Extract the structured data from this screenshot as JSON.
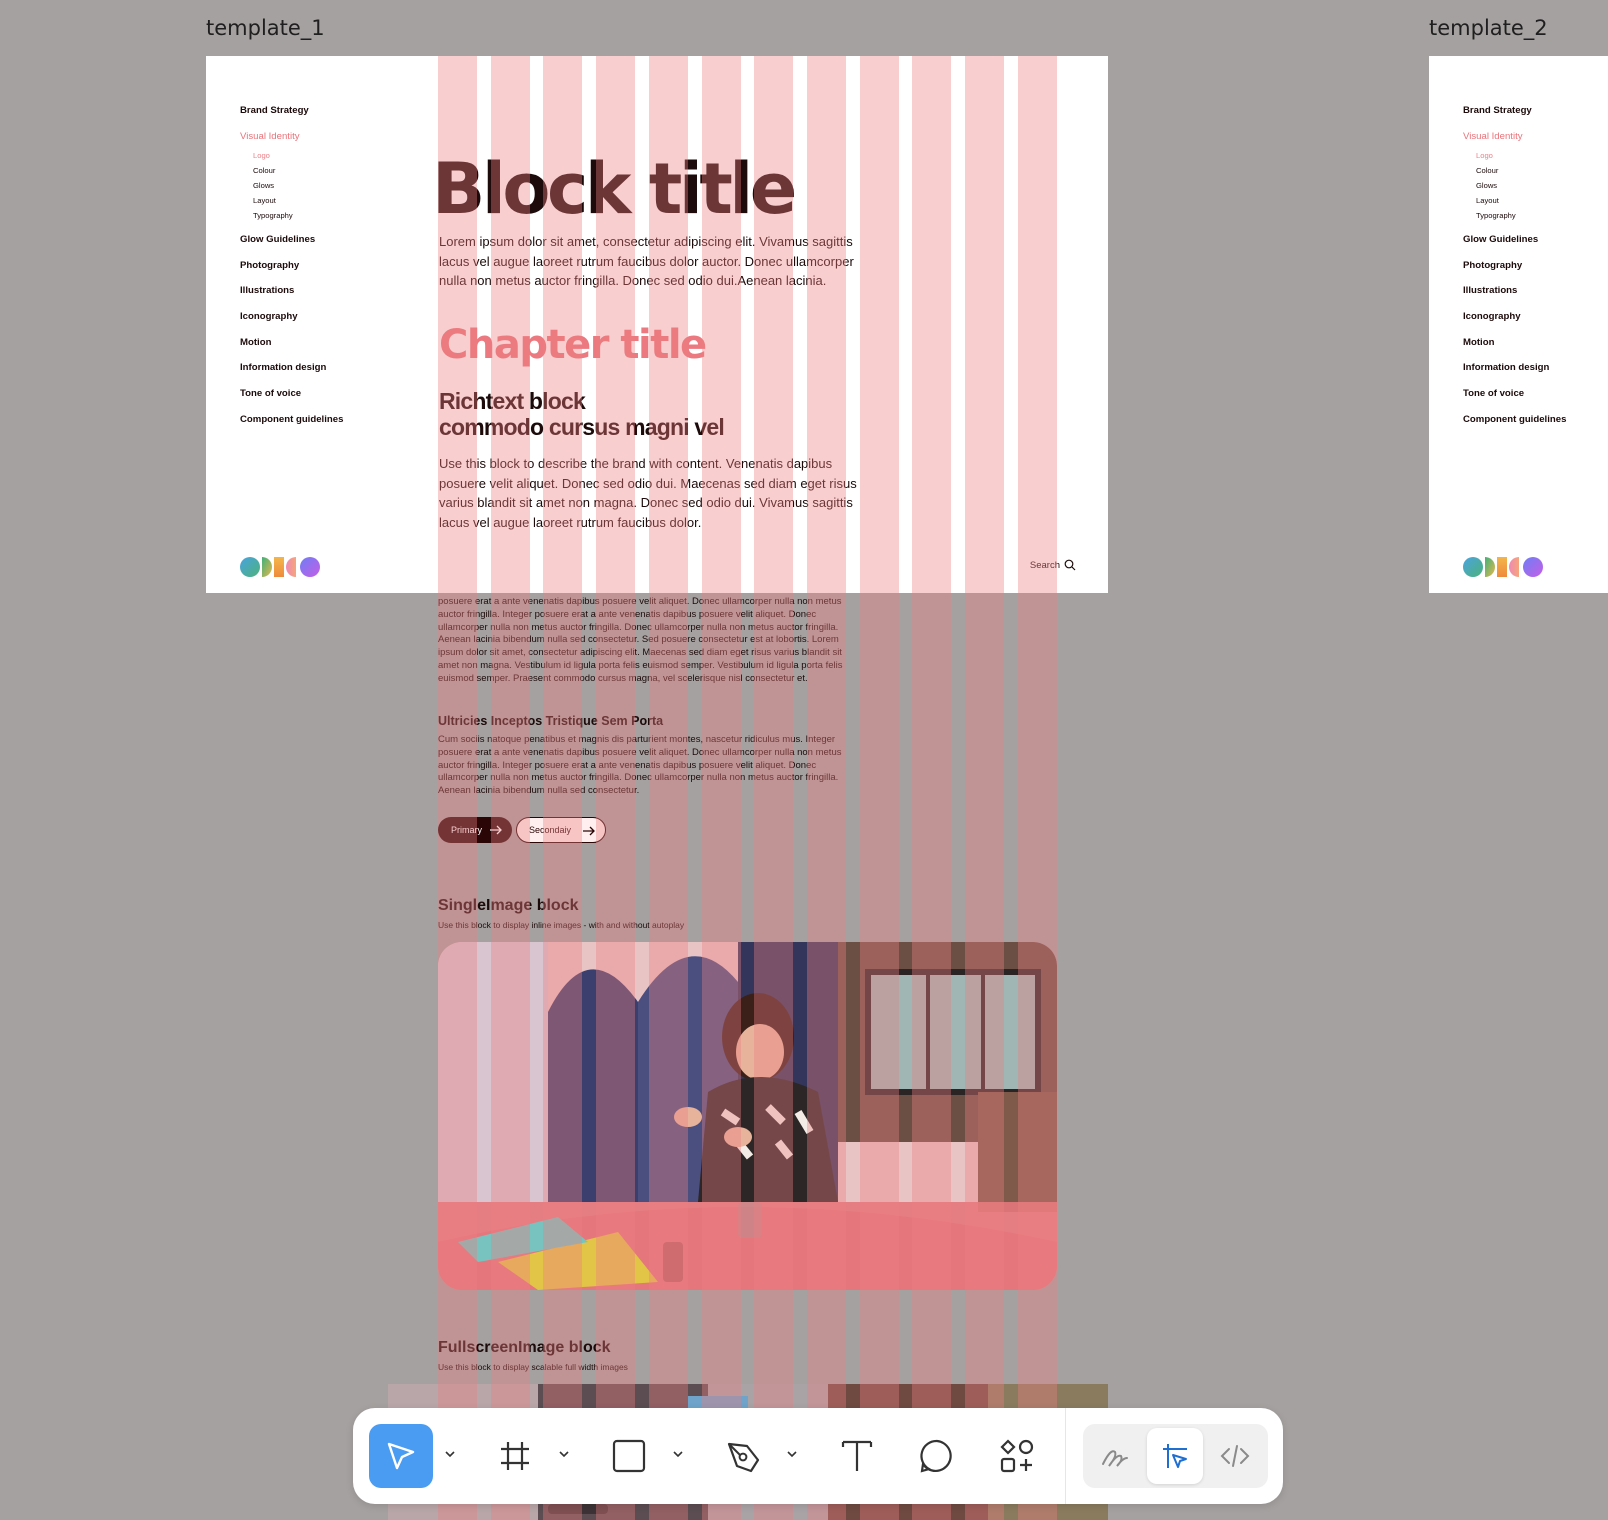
{
  "canvas": {
    "frames": [
      {
        "label": "template_1"
      },
      {
        "label": "template_2"
      }
    ]
  },
  "template": {
    "nav": {
      "items": [
        {
          "label": "Brand Strategy"
        },
        {
          "label": "Visual Identity",
          "active": true
        },
        {
          "label": "Glow Guidelines"
        },
        {
          "label": "Photography"
        },
        {
          "label": "Illustrations"
        },
        {
          "label": "Iconography"
        },
        {
          "label": "Motion"
        },
        {
          "label": "Information design"
        },
        {
          "label": "Tone of voice"
        },
        {
          "label": "Component guidelines"
        }
      ],
      "subitems": [
        {
          "label": "Logo",
          "active": true
        },
        {
          "label": "Colour"
        },
        {
          "label": "Glows"
        },
        {
          "label": "Layout"
        },
        {
          "label": "Typography"
        }
      ]
    },
    "block_title": "Block title",
    "intro_text": "Lorem ipsum dolor sit amet, consectetur adipiscing elit. Vivamus sagittis lacus vel augue laoreet rutrum faucibus dolor auctor. Donec ullamcorper nulla non metus auctor fringilla. Donec sed odio dui.Aenean lacinia.",
    "chapter_title": "Chapter title",
    "richtext_heading_line1": "Richtext block",
    "richtext_heading_line2": "commodo cursus magni vel",
    "richtext_body": "Use this block to describe the brand with content. Venenatis dapibus posuere velit aliquet. Donec sed odio dui. Maecenas sed diam eget risus varius blandit sit amet non magna. Donec sed odio dui. Vivamus sagittis lacus vel augue laoreet rutrum faucibus dolor.",
    "search_label": "Search"
  },
  "overflow": {
    "paragraph1": "posuere erat a ante venenatis dapibus posuere velit aliquet. Donec ullamcorper nulla non metus auctor fringilla. Integer posuere erat a ante venenatis dapibus posuere velit aliquet. Donec ullamcorper nulla non metus auctor fringilla.  Donec ullamcorper nulla non metus auctor fringilla. Aenean lacinia bibendum nulla sed consectetur. Sed posuere consectetur est at lobortis. Lorem ipsum dolor sit amet, consectetur adipiscing elit.  Maecenas sed diam eget risus varius blandit sit amet non magna. Vestibulum id ligula porta felis euismod semper. Vestibulum id ligula porta felis euismod semper. Praesent commodo cursus magna, vel scelerisque nisl consectetur et.",
    "subheading": "Ultricies Inceptos Tristique Sem Porta",
    "paragraph2": "Cum sociis natoque penatibus et magnis dis parturient montes, nascetur ridiculus mus. Integer posuere erat a ante venenatis dapibus posuere velit aliquet. Donec ullamcorper nulla non metus auctor fringilla. Integer posuere erat a ante venenatis dapibus posuere velit aliquet. Donec ullamcorper nulla non metus auctor fringilla.  Donec ullamcorper nulla non metus auctor fringilla. Aenean lacinia bibendum nulla sed consectetur.",
    "primary_button": "Primary",
    "secondary_button": "Secondaiy",
    "single_image_heading": "SingleImage block",
    "single_image_sub": "Use this block to display inline images - with and without autoplay",
    "fullscreen_heading": "FullscreenImage block",
    "fullscreen_sub": "Use this block to display scalable full width images"
  },
  "toolbar": {
    "tools": [
      {
        "icon": "move-pointer-icon",
        "selected": true,
        "has_menu": true
      },
      {
        "icon": "frame-icon",
        "has_menu": true
      },
      {
        "icon": "rectangle-icon",
        "has_menu": true
      },
      {
        "icon": "pen-icon",
        "has_menu": true
      },
      {
        "icon": "text-icon"
      },
      {
        "icon": "comment-icon"
      },
      {
        "icon": "actions-icon"
      }
    ],
    "modes": [
      {
        "icon": "draw-mode-icon"
      },
      {
        "icon": "design-mode-icon",
        "selected": true
      },
      {
        "icon": "dev-mode-icon"
      }
    ]
  },
  "colors": {
    "canvas_bg": "#a5a1a0",
    "accent_pink": "#ec7980",
    "dark_text": "#1d0a0a",
    "selected_blue": "#4a9cf3",
    "column_overlay": "rgba(236,125,130,0.38)"
  }
}
